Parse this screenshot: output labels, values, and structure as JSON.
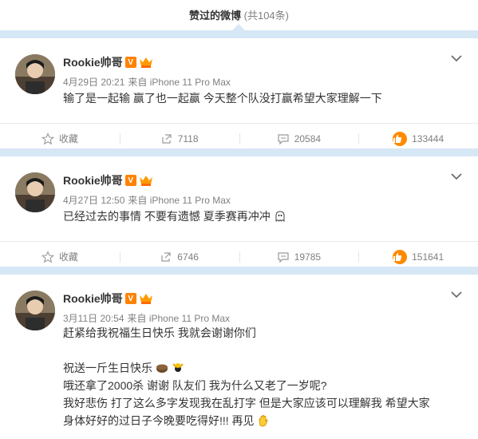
{
  "header": {
    "title": "赞过的微博",
    "count": "(共104条)"
  },
  "colors": {
    "separator": "#d6e7f6",
    "accent": "#ff8200",
    "meta": "#808080"
  },
  "actions_labels": {
    "favorite": "收藏"
  },
  "posts": [
    {
      "author": "Rookie帅哥",
      "vip_level": "6",
      "time": "4月29日 20:21",
      "source": "来自 iPhone 11 Pro Max",
      "lines": [
        "输了是一起输 赢了也一起赢 今天整个队没打赢希望大家理解一下"
      ],
      "reposts": "7118",
      "comments": "20584",
      "likes": "133444"
    },
    {
      "author": "Rookie帅哥",
      "vip_level": "6",
      "time": "4月27日 12:50",
      "source": "来自 iPhone 11 Pro Max",
      "lines": [
        "已经过去的事情 不要有遗憾 夏季赛再冲冲"
      ],
      "reposts": "6746",
      "comments": "19785",
      "likes": "151641"
    },
    {
      "author": "Rookie帅哥",
      "vip_level": "6",
      "time": "3月11日 20:54",
      "source": "来自 iPhone 11 Pro Max",
      "lines": [
        "赶紧给我祝福生日快乐 我就会谢谢你们",
        "",
        "祝送一斤生日快乐",
        "哦还拿了2000杀 谢谢 队友们 我为什么又老了一岁呢?",
        "我好悲伤 打了这么多字发现我在乱打字 但是大家应该可以理解我 希望大家",
        "身体好好的过日子今晚要吃得好!!! 再见"
      ]
    }
  ]
}
